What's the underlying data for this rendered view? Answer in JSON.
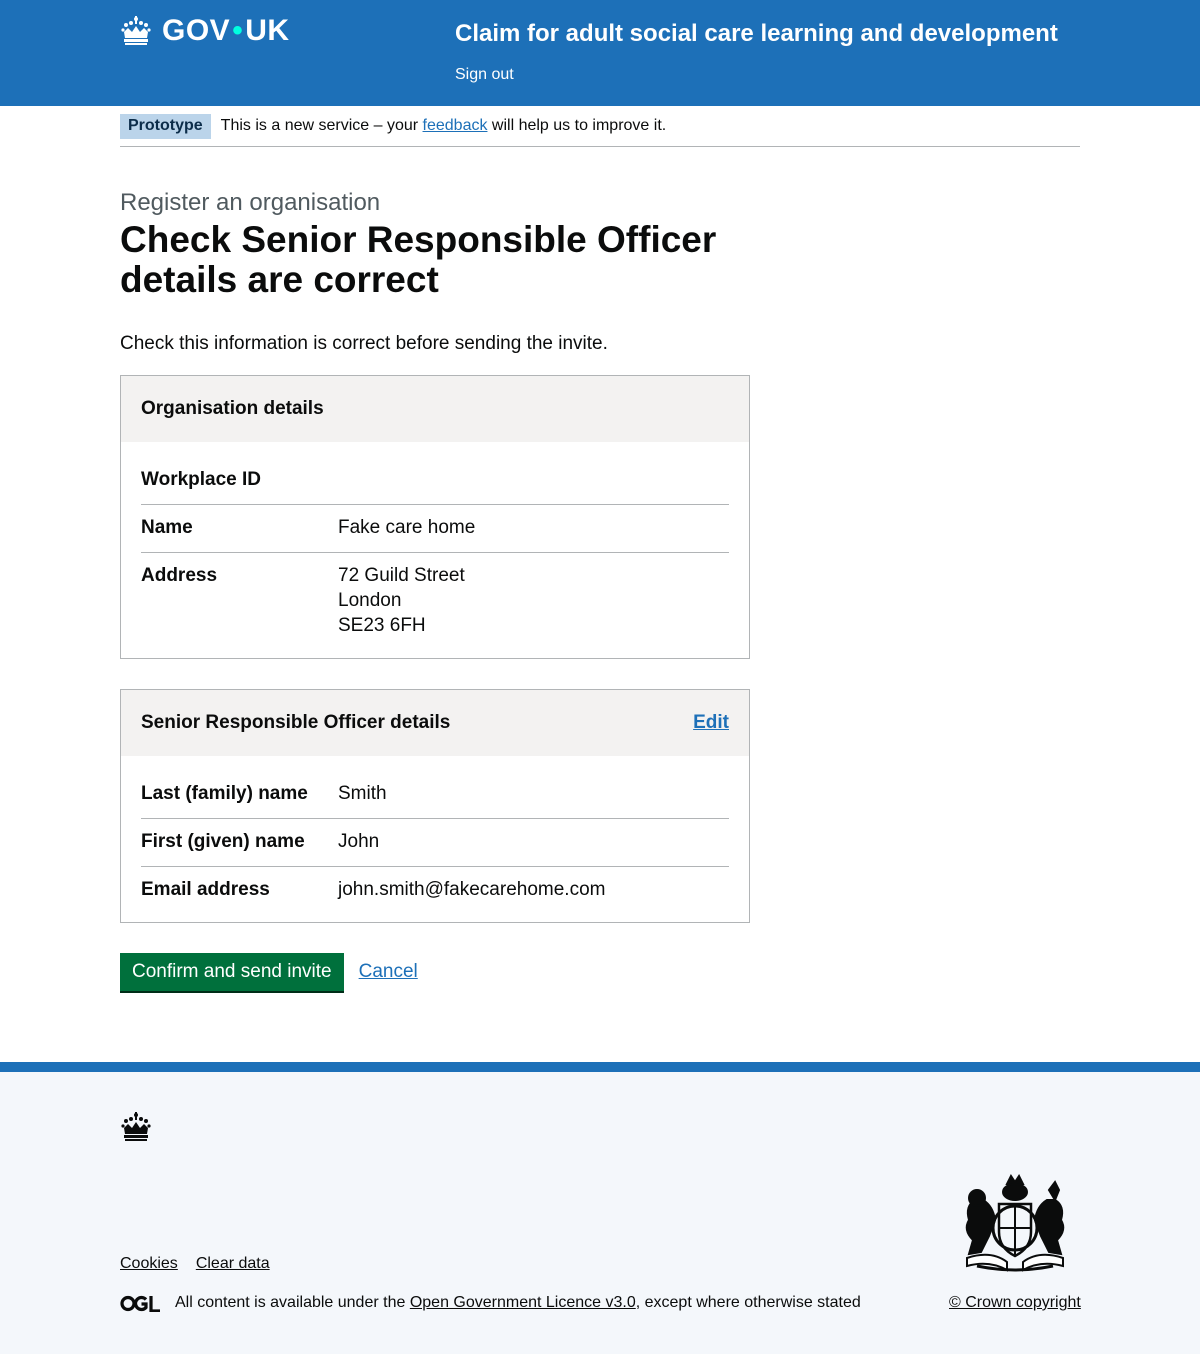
{
  "header": {
    "logo_text_left": "GOV",
    "logo_dot": "•",
    "logo_text_right": "UK",
    "service_name": "Claim for adult social care learning and development",
    "sign_out": "Sign out"
  },
  "phase_banner": {
    "tag": "Prototype",
    "text_before": "This is a new service – your ",
    "link": "feedback",
    "text_after": " will help us to improve it."
  },
  "main": {
    "caption": "Register an organisation",
    "title": "Check Senior Responsible Officer details are correct",
    "lede": "Check this information is correct before sending the invite."
  },
  "organisation_card": {
    "title": "Organisation details",
    "rows": [
      {
        "key": "Workplace ID",
        "value": []
      },
      {
        "key": "Name",
        "value": [
          "Fake care home"
        ]
      },
      {
        "key": "Address",
        "value": [
          "72 Guild Street",
          "London",
          "SE23 6FH"
        ]
      }
    ]
  },
  "officer_card": {
    "title": "Senior Responsible Officer details",
    "edit": "Edit",
    "rows": [
      {
        "key": "Last (family) name",
        "value": [
          "Smith"
        ]
      },
      {
        "key": "First (given) name",
        "value": [
          "John"
        ]
      },
      {
        "key": "Email address",
        "value": [
          "john.smith@fakecarehome.com"
        ]
      }
    ]
  },
  "actions": {
    "confirm": "Confirm and send invite",
    "cancel": "Cancel"
  },
  "footer": {
    "links": [
      "Cookies",
      "Clear data"
    ],
    "licence_before": "All content is available under the ",
    "licence_link": "Open Government Licence v3.0",
    "licence_after": ", except where otherwise stated",
    "copyright": "© Crown copyright"
  },
  "colors": {
    "brand_blue": "#1d70b8",
    "button_green": "#00703c",
    "tag_blue": "#bbd4ea",
    "card_header_grey": "#f3f2f1"
  }
}
